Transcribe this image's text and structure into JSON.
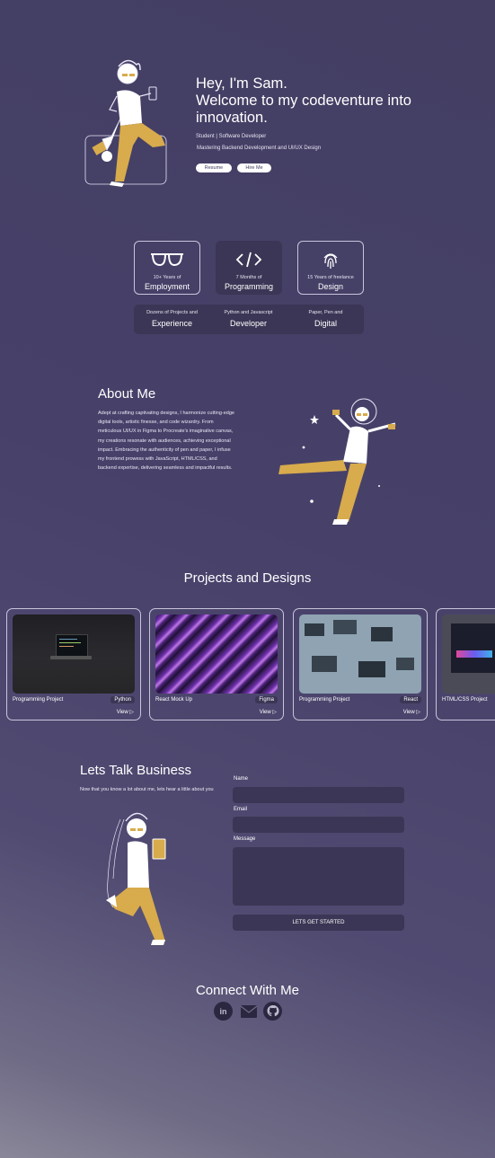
{
  "hero": {
    "title_line1": "Hey, I'm Sam.",
    "title_line2": "Welcome to my codeventure into",
    "title_line3": "innovation.",
    "tagline": "Student | Software Developer",
    "subtagline": "Mastering Backend Development and UI/UX Design",
    "resume_label": "Resume",
    "hire_label": "Hire Me"
  },
  "stats": [
    {
      "small": "10+ Years of",
      "big": "Employment",
      "icon": "glasses-icon"
    },
    {
      "small": "7 Months of",
      "big": "Programming",
      "icon": "code-icon"
    },
    {
      "small": "15 Years of freelance",
      "big": "Design",
      "icon": "fingerprint-icon"
    }
  ],
  "experience": [
    {
      "small": "Dozens of Projects and",
      "big": "Experience"
    },
    {
      "small": "Python and Javascript",
      "big": "Developer"
    },
    {
      "small": "Paper, Pen and",
      "big": "Digital"
    }
  ],
  "about": {
    "heading": "About Me",
    "text": "Adept at crafting captivating designs, I harmonize cutting-edge digital tools, artistic finesse, and code wizardry. From meticulous UI/UX in Figma to Procreate's imaginative canvas, my creations resonate with audiences, achieving exceptional impact. Embracing the authenticity of pen and paper, I infuse my frontend prowess with JavaScript, HTML/CSS, and backend expertise, delivering seamless and impactful results."
  },
  "projects": {
    "heading": "Projects and Designs",
    "items": [
      {
        "name": "Programming Project",
        "tag": "Python",
        "view": "View"
      },
      {
        "name": "React Mock Up",
        "tag": "Figma",
        "view": "View"
      },
      {
        "name": "Programming Project",
        "tag": "React",
        "view": "View"
      },
      {
        "name": "HTML/CSS Project",
        "tag": "",
        "view": ""
      }
    ]
  },
  "contact": {
    "heading": "Lets Talk Business",
    "subtext": "Now that you know a lot about me, lets hear a little about you",
    "name_label": "Name",
    "email_label": "Email",
    "message_label": "Message",
    "submit_label": "LETS GET STARTED"
  },
  "connect": {
    "heading": "Connect With Me",
    "icons": [
      "linkedin-icon",
      "mail-icon",
      "github-icon"
    ]
  },
  "colors": {
    "accent_gold": "#d8ab4c",
    "card_dark": "#3b3655"
  }
}
